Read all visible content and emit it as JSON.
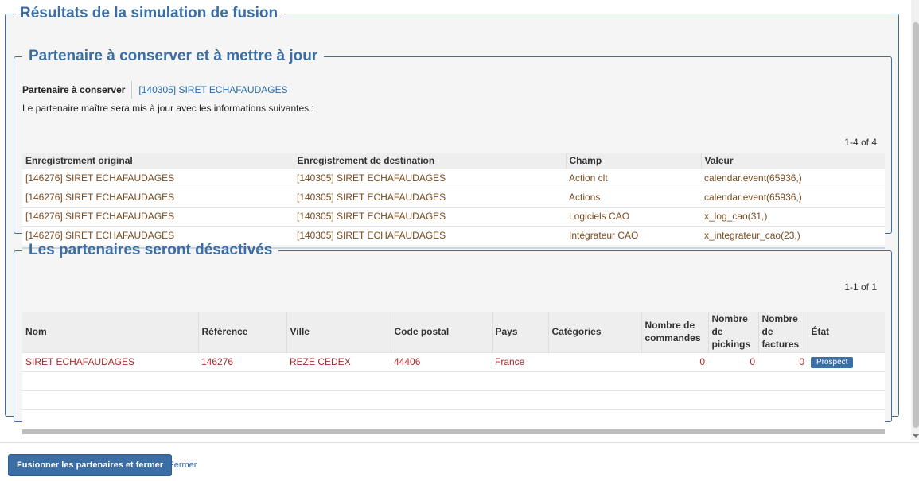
{
  "main": {
    "title": "Résultats de la simulation de fusion"
  },
  "keep_section": {
    "title": "Partenaire à conserver et à mettre à jour",
    "field_label": "Partenaire à conserver",
    "field_value": "[140305] SIRET ECHAFAUDAGES",
    "info": "Le partenaire maître sera mis à jour avec les informations suivantes :",
    "pager": "1-4 of 4",
    "columns": [
      "Enregistrement original",
      "Enregistrement de destination",
      "Champ",
      "Valeur"
    ],
    "rows": [
      [
        "[146276] SIRET ECHAFAUDAGES",
        "[140305] SIRET ECHAFAUDAGES",
        "Action clt",
        "calendar.event(65936,)"
      ],
      [
        "[146276] SIRET ECHAFAUDAGES",
        "[140305] SIRET ECHAFAUDAGES",
        "Actions",
        "calendar.event(65936,)"
      ],
      [
        "[146276] SIRET ECHAFAUDAGES",
        "[140305] SIRET ECHAFAUDAGES",
        "Logiciels CAO",
        "x_log_cao(31,)"
      ],
      [
        "[146276] SIRET ECHAFAUDAGES",
        "[140305] SIRET ECHAFAUDAGES",
        "Intégrateur CAO",
        "x_integrateur_cao(23,)"
      ]
    ]
  },
  "deact_section": {
    "title": "Les partenaires seront désactivés",
    "pager": "1-1 of 1",
    "columns": {
      "nom": "Nom",
      "reference": "Référence",
      "ville": "Ville",
      "code_postal": "Code postal",
      "pays": "Pays",
      "categories": "Catégories",
      "commandes_1": "Nombre de",
      "commandes_2": "commandes",
      "pickings_1": "Nombre",
      "pickings_2": "de",
      "pickings_3": "pickings",
      "factures_1": "Nombre",
      "factures_2": "de",
      "factures_3": "factures",
      "etat": "État"
    },
    "row": {
      "nom": "SIRET ECHAFAUDAGES",
      "reference": "146276",
      "ville": "REZE CEDEX",
      "code_postal": "44406",
      "pays": "France",
      "categories": "",
      "commandes": "0",
      "pickings": "0",
      "factures": "0",
      "etat": "Prospect"
    }
  },
  "footer": {
    "merge_button": "Fusionner les partenaires et fermer",
    "close_link": "Fermer"
  },
  "colors": {
    "accent": "#3a6ea5",
    "link": "#2a6aa8",
    "row_text_keep": "#7a4b1f",
    "row_text_deact": "#a52a2a"
  }
}
